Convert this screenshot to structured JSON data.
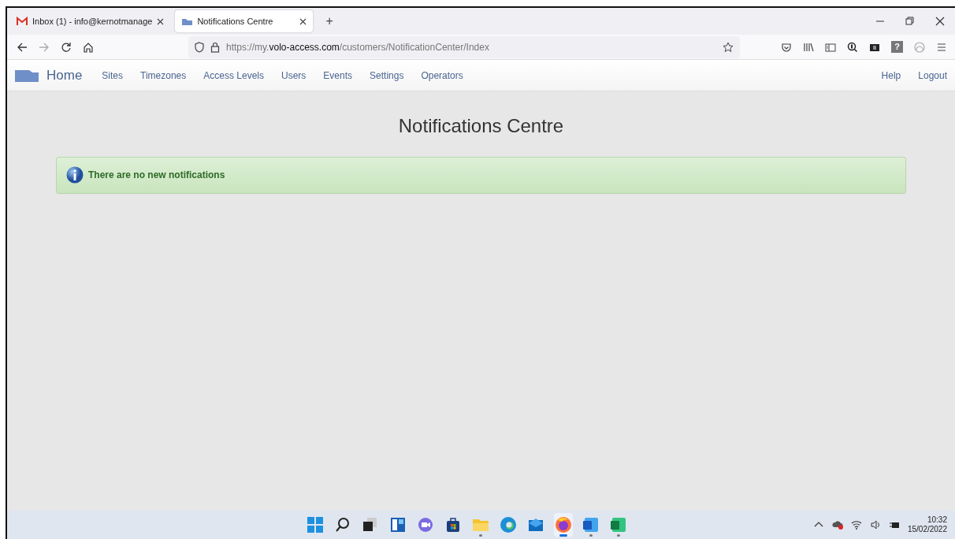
{
  "browser": {
    "tabs": [
      {
        "title": "Inbox (1) - info@kernotmanage",
        "kind": "mail",
        "selected": false
      },
      {
        "title": "Notifications Centre",
        "kind": "folder",
        "selected": true
      }
    ],
    "new_tab": "+",
    "address": {
      "prefix": "https://my.",
      "domain": "volo-access.com",
      "path": "/customers/NotificationCenter/Index"
    },
    "extension_glyph": "?"
  },
  "site_nav": {
    "brand": "Home",
    "items": [
      "Sites",
      "Timezones",
      "Access Levels",
      "Users",
      "Events",
      "Settings",
      "Operators"
    ],
    "right_items": [
      "Help",
      "Logout"
    ]
  },
  "page": {
    "title": "Notifications Centre",
    "alert": "There are no new notifications"
  },
  "taskbar": {
    "apps": [
      {
        "kind": "start",
        "running": false,
        "active": false
      },
      {
        "kind": "search",
        "running": false,
        "active": false
      },
      {
        "kind": "taskview",
        "running": false,
        "active": false
      },
      {
        "kind": "widgets",
        "running": false,
        "active": false
      },
      {
        "kind": "chat",
        "running": false,
        "active": false
      },
      {
        "kind": "store",
        "running": false,
        "active": false
      },
      {
        "kind": "files",
        "running": true,
        "active": false
      },
      {
        "kind": "edge",
        "running": false,
        "active": false
      },
      {
        "kind": "mail",
        "running": false,
        "active": false
      },
      {
        "kind": "firefox",
        "running": true,
        "active": true
      },
      {
        "kind": "word",
        "running": true,
        "active": false
      },
      {
        "kind": "excel",
        "running": true,
        "active": false
      }
    ],
    "time": "10:32",
    "date": "15/02/2022"
  }
}
